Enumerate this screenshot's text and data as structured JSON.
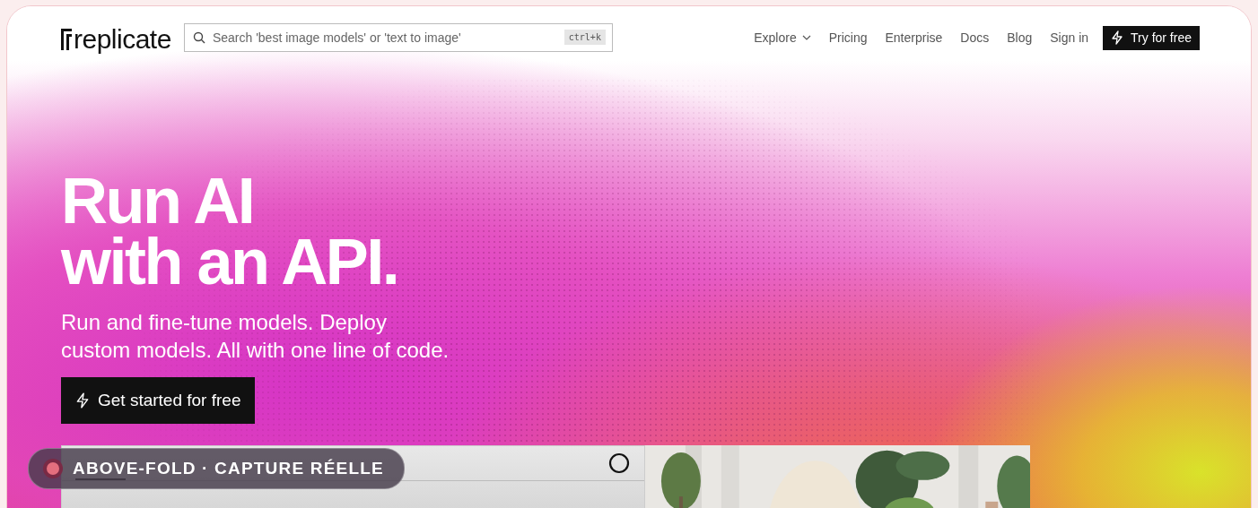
{
  "nav": {
    "logo": "replicate",
    "search": {
      "placeholder": "Search 'best image models' or 'text to image'",
      "shortcut": "ctrl+k"
    },
    "links": [
      {
        "label": "Explore",
        "kind": "menu"
      },
      {
        "label": "Pricing",
        "kind": "link"
      },
      {
        "label": "Enterprise",
        "kind": "link"
      },
      {
        "label": "Docs",
        "kind": "link"
      },
      {
        "label": "Blog",
        "kind": "link"
      },
      {
        "label": "Sign in",
        "kind": "link"
      }
    ],
    "cta": "Try for free"
  },
  "hero": {
    "title_lines": [
      "Run AI",
      "with an API."
    ],
    "subtitle_lines": [
      "Run and fine-tune models. Deploy",
      "custom models. All with one line of code."
    ],
    "button": "Get started for free"
  },
  "badge": {
    "label": "ABOVE-FOLD · CAPTURE RÉELLE"
  }
}
